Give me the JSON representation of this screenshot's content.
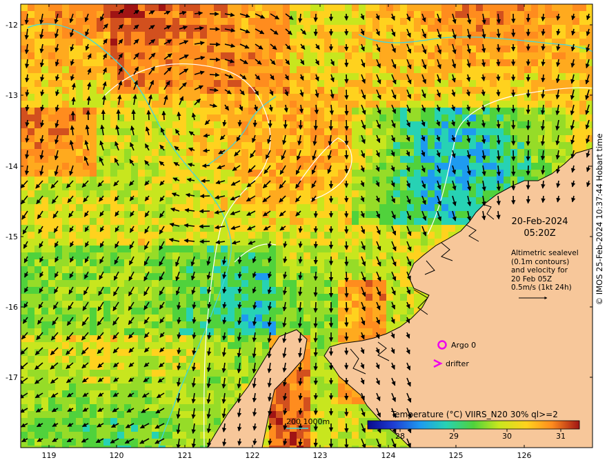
{
  "map": {
    "lat_ticks": [
      "-12",
      "-13",
      "-14",
      "-15",
      "-16",
      "-17"
    ],
    "lon_ticks": [
      "119",
      "120",
      "121",
      "122",
      "123",
      "124",
      "125",
      "126"
    ],
    "land_color": "#f7c79a",
    "coast_color": "#000000",
    "contour_color": "#3fd7e0",
    "sealevel_contour_color": "#ffffff"
  },
  "annotation": {
    "date": "20-Feb-2024",
    "time": "05:20Z",
    "info_lines": [
      "Altimetric sealevel",
      "(0.1m contours)",
      "and velocity for",
      "20 Feb 05Z",
      "0.5m/s (1kt 24h)"
    ]
  },
  "legend": {
    "argo_label": "Argo 0",
    "drifter_label": "drifter",
    "argo_icon": "circle-marker-icon",
    "drifter_icon": "chevron-right-icon",
    "marker_color": "#ee00ee"
  },
  "colorbar": {
    "title": "Temperature (°C) VIIRS_N20 30% ql>=2",
    "ticks": [
      "28",
      "29",
      "30",
      "31"
    ],
    "range": [
      27.4,
      31.4
    ]
  },
  "contour_legend": "200  1000m",
  "copyright": "© IMOS 25-Feb-2024 10:37:44 Hobart time"
}
